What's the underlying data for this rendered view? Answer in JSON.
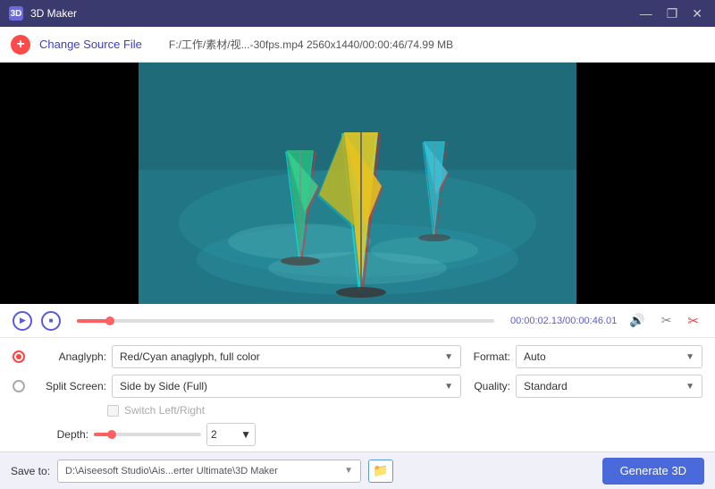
{
  "titleBar": {
    "icon": "3D",
    "title": "3D Maker",
    "minimizeLabel": "—",
    "restoreLabel": "❐",
    "closeLabel": "✕"
  },
  "toolbar": {
    "addIcon": "+",
    "changeSourceLabel": "Change Source File",
    "fileInfo": "F:/工作/素材/视...-30fps.mp4    2560x1440/00:00:46/74.99 MB"
  },
  "controls": {
    "playIcon": "▶",
    "stopIcon": "■",
    "timeDisplay": "00:00:02.13/00:00:46.01",
    "volumeIcon": "🔊",
    "settingsIcon": "⚙",
    "cutIcon": "✂"
  },
  "settings": {
    "anaglyphLabel": "Anaglyph:",
    "anaglyphValue": "Red/Cyan anaglyph, full color",
    "splitScreenLabel": "Split Screen:",
    "splitScreenValue": "Side by Side (Full)",
    "switchLeftRightLabel": "Switch Left/Right",
    "depthLabel": "Depth:",
    "depthValue": "2",
    "formatLabel": "Format:",
    "formatValue": "Auto",
    "qualityLabel": "Quality:",
    "qualityValue": "Standard"
  },
  "saveBar": {
    "saveToLabel": "Save to:",
    "savePath": "D:\\Aiseesoft Studio\\Ais...erter Ultimate\\3D Maker",
    "generateLabel": "Generate 3D"
  }
}
